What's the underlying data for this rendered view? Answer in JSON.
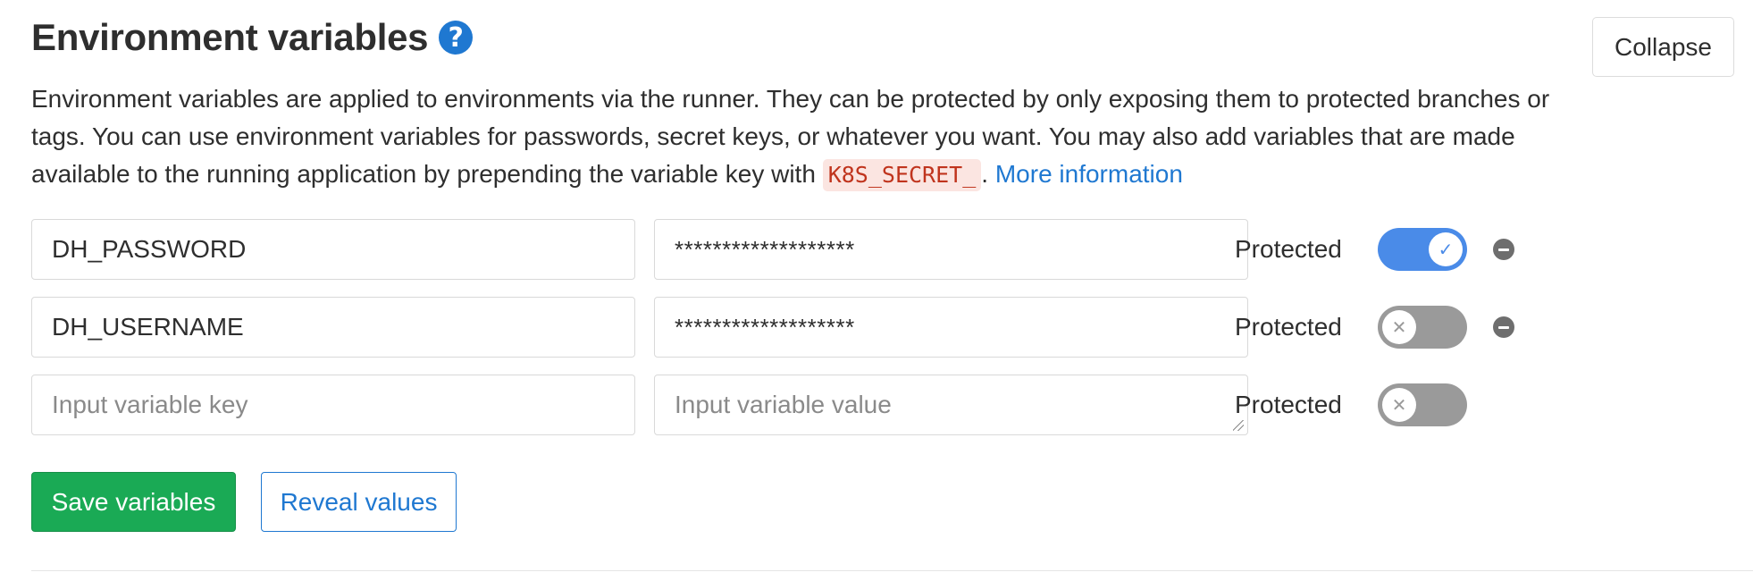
{
  "section": {
    "title": "Environment variables",
    "help_icon": "question-circle-icon",
    "collapse_label": "Collapse"
  },
  "description": {
    "text_before": "Environment variables are applied to environments via the runner. They can be protected by only exposing them to protected branches or tags. You can use environment variables for passwords, secret keys, or whatever you want. You may also add variables that are made available to the running application by prepending the variable key with ",
    "code": "K8S_SECRET_",
    "text_after": ". ",
    "link_text": "More information"
  },
  "variables": [
    {
      "key": "DH_PASSWORD",
      "value": "*******************",
      "protected_label": "Protected",
      "protected": true
    },
    {
      "key": "DH_USERNAME",
      "value": "*******************",
      "protected_label": "Protected",
      "protected": false
    }
  ],
  "new_variable": {
    "key_placeholder": "Input variable key",
    "value_placeholder": "Input variable value",
    "protected_label": "Protected",
    "protected": false
  },
  "actions": {
    "save_label": "Save variables",
    "reveal_label": "Reveal values"
  },
  "colors": {
    "accent": "#1f78d1",
    "success": "#1aaa55",
    "toggle_on": "#4a8be8",
    "toggle_off": "#9a9a9a",
    "code_bg": "#fbe5e1",
    "code_text": "#c0341d"
  }
}
